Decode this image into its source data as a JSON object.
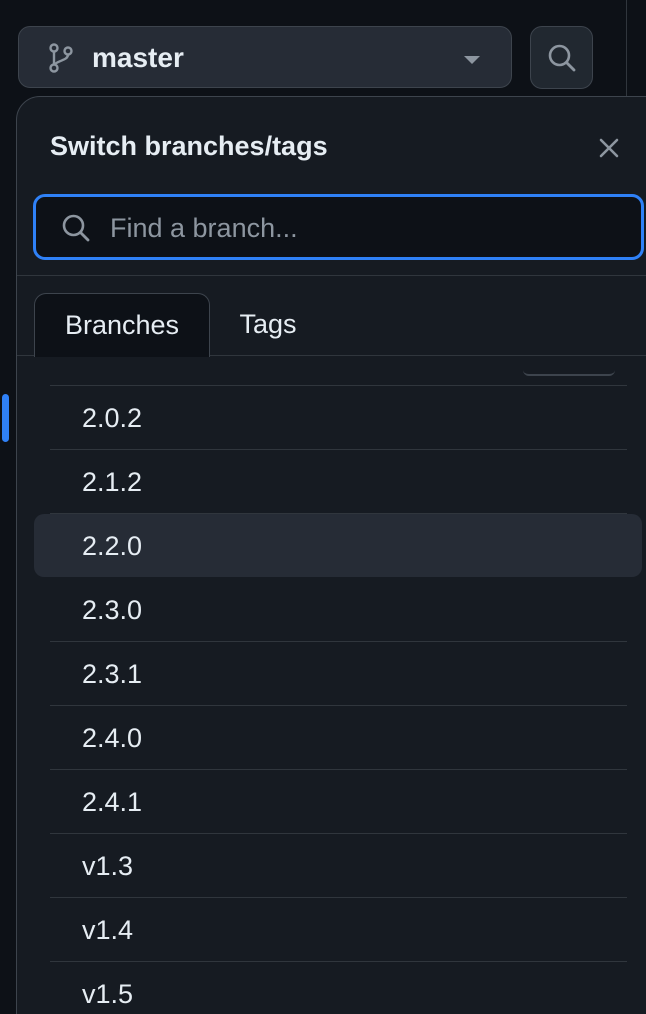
{
  "branch_selector": {
    "current_branch": "master"
  },
  "panel": {
    "title": "Switch branches/tags",
    "search_placeholder": "Find a branch..."
  },
  "tabs": [
    {
      "label": "Branches",
      "active": true
    },
    {
      "label": "Tags",
      "active": false
    }
  ],
  "branches": [
    {
      "name": "2.0.2",
      "selected": false
    },
    {
      "name": "2.1.2",
      "selected": false
    },
    {
      "name": "2.2.0",
      "selected": true
    },
    {
      "name": "2.3.0",
      "selected": false
    },
    {
      "name": "2.3.1",
      "selected": false
    },
    {
      "name": "2.4.0",
      "selected": false
    },
    {
      "name": "2.4.1",
      "selected": false
    },
    {
      "name": "v1.3",
      "selected": false
    },
    {
      "name": "v1.4",
      "selected": false
    },
    {
      "name": "v1.5",
      "selected": false
    }
  ],
  "colors": {
    "accent": "#2f81f7",
    "background": "#0d1117",
    "panel": "#161b22",
    "selected_row": "#262c36"
  },
  "icons": {
    "branch": "git-branch-icon",
    "search": "search-icon",
    "close": "close-icon",
    "caret": "caret-down-icon"
  }
}
